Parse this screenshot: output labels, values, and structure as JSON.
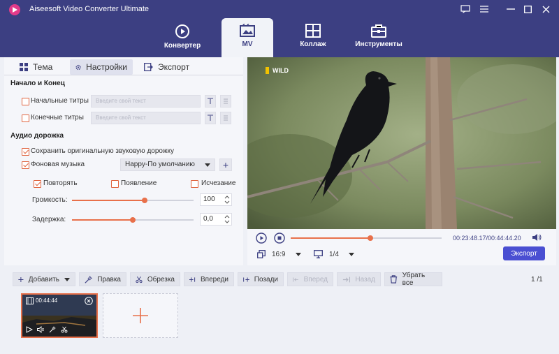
{
  "app": {
    "title": "Aiseesoft Video Converter Ultimate"
  },
  "nav": {
    "tabs": [
      {
        "label": "Конвертер",
        "icon": "convert-icon"
      },
      {
        "label": "MV",
        "icon": "mv-icon",
        "active": true
      },
      {
        "label": "Коллаж",
        "icon": "collage-icon"
      },
      {
        "label": "Инструменты",
        "icon": "toolbox-icon"
      }
    ]
  },
  "subtabs": [
    {
      "label": "Тема",
      "icon": "theme-icon"
    },
    {
      "label": "Настройки",
      "icon": "gear-icon",
      "active": true
    },
    {
      "label": "Экспорт",
      "icon": "export-icon"
    }
  ],
  "settings": {
    "start_end_title": "Начало и Конец",
    "start_titles_label": "Начальные титры",
    "end_titles_label": "Конечные титры",
    "text_placeholder": "Введите свой текст",
    "audio_title": "Аудио дорожка",
    "keep_audio_label": "Сохранить оригинальную звуковую дорожку",
    "bg_music_label": "Фоновая музыка",
    "bg_music_value": "Happy-По умолчанию",
    "repeat_label": "Повторять",
    "fade_in_label": "Появление",
    "fade_out_label": "Исчезание",
    "volume_label": "Громкость:",
    "volume_value": "100",
    "volume_level": 0.6,
    "delay_label": "Задержка:",
    "delay_value": "0,0",
    "delay_level": 0.5
  },
  "preview": {
    "watermark": "WILD",
    "time": "00:23:48.17/00:44:44.20",
    "progress": 0.53,
    "aspect": "16:9",
    "page": "1/4",
    "export_label": "Экспорт"
  },
  "toolbar": {
    "add": "Добавить",
    "edit": "Правка",
    "trim": "Обрезка",
    "ahead": "Впереди",
    "behind": "Позади",
    "forward": "Вперед",
    "back": "Назад",
    "clear": "Убрать все",
    "page_current": "1",
    "page_total": "/1"
  },
  "clip": {
    "duration": "00:44:44"
  },
  "colors": {
    "accent": "#e8704a",
    "brand": "#3c3f82",
    "button": "#4a4fd2"
  }
}
